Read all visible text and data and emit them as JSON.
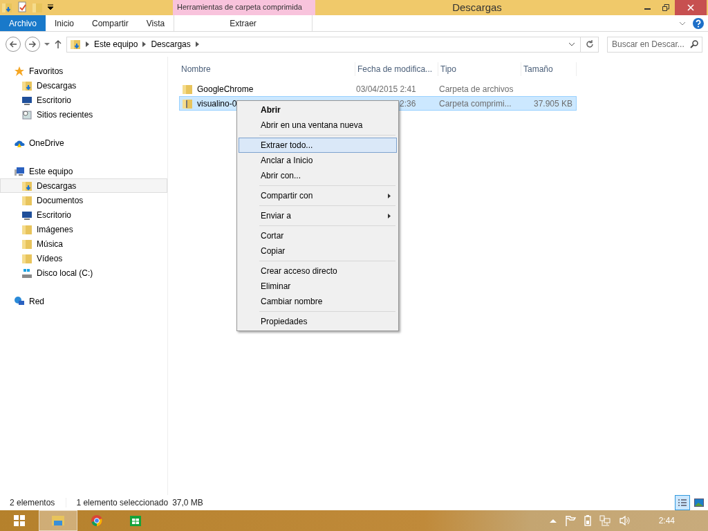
{
  "window": {
    "title": "Descargas"
  },
  "quick_access": [
    {
      "kind": "downloads"
    },
    {
      "kind": "properties"
    },
    {
      "kind": "folder"
    }
  ],
  "ribbon": {
    "context_header": "Herramientas de carpeta comprimida",
    "tabs": [
      {
        "label": "Archivo",
        "kind": "file"
      },
      {
        "label": "Inicio",
        "kind": "tab"
      },
      {
        "label": "Compartir",
        "kind": "tab"
      },
      {
        "label": "Vista",
        "kind": "tab"
      },
      {
        "label": "Extraer",
        "kind": "context"
      }
    ]
  },
  "address": {
    "path": [
      "Este equipo",
      "Descargas"
    ]
  },
  "search": {
    "placeholder": "Buscar en Descar..."
  },
  "sidebar": {
    "items": [
      {
        "label": "Favoritos",
        "kind": "star",
        "selected": false,
        "children": [
          {
            "label": "Descargas",
            "kind": "downloads",
            "selected": false
          },
          {
            "label": "Escritorio",
            "kind": "desktop",
            "selected": false
          },
          {
            "label": "Sitios recientes",
            "kind": "recent",
            "selected": false
          }
        ]
      },
      {
        "label": "OneDrive",
        "kind": "cloud",
        "selected": false
      },
      {
        "label": "Este equipo",
        "kind": "computer",
        "selected": false,
        "children": [
          {
            "label": "Descargas",
            "kind": "downloads",
            "selected": true
          },
          {
            "label": "Documentos",
            "kind": "folder",
            "selected": false
          },
          {
            "label": "Escritorio",
            "kind": "desktop",
            "selected": false
          },
          {
            "label": "Imágenes",
            "kind": "folder",
            "selected": false
          },
          {
            "label": "Música",
            "kind": "folder",
            "selected": false
          },
          {
            "label": "Vídeos",
            "kind": "folder",
            "selected": false
          },
          {
            "label": "Disco local (C:)",
            "kind": "drive",
            "selected": false
          }
        ]
      },
      {
        "label": "Red",
        "kind": "network",
        "selected": false
      }
    ]
  },
  "table": {
    "columns": [
      "Nombre",
      "Fecha de modifica...",
      "Tipo",
      "Tamaño"
    ],
    "rows": [
      {
        "kind": "folder",
        "selected": false,
        "cells": [
          "GoogleChrome",
          "03/04/2015 2:41",
          "Carpeta de archivos",
          ""
        ]
      },
      {
        "kind": "zip",
        "selected": true,
        "cells": [
          "visualino-0",
          "2:36",
          "Carpeta comprimi...",
          "37.905 KB"
        ]
      }
    ]
  },
  "context_menu": {
    "groups": [
      [
        {
          "label": "Abrir",
          "default": true,
          "selected": false,
          "submenu": false
        },
        {
          "label": "Abrir en una ventana nueva",
          "default": false,
          "selected": false,
          "submenu": false
        }
      ],
      [
        {
          "label": "Extraer todo...",
          "default": false,
          "selected": true,
          "submenu": false
        },
        {
          "label": "Anclar a Inicio",
          "default": false,
          "selected": false,
          "submenu": false
        },
        {
          "label": "Abrir con...",
          "default": false,
          "selected": false,
          "submenu": false
        }
      ],
      [
        {
          "label": "Compartir con",
          "default": false,
          "selected": false,
          "submenu": true
        }
      ],
      [
        {
          "label": "Enviar a",
          "default": false,
          "selected": false,
          "submenu": true
        }
      ],
      [
        {
          "label": "Cortar",
          "default": false,
          "selected": false,
          "submenu": false
        },
        {
          "label": "Copiar",
          "default": false,
          "selected": false,
          "submenu": false
        }
      ],
      [
        {
          "label": "Crear acceso directo",
          "default": false,
          "selected": false,
          "submenu": false
        },
        {
          "label": "Eliminar",
          "default": false,
          "selected": false,
          "submenu": false
        },
        {
          "label": "Cambiar nombre",
          "default": false,
          "selected": false,
          "submenu": false
        }
      ],
      [
        {
          "label": "Propiedades",
          "default": false,
          "selected": false,
          "submenu": false
        }
      ]
    ]
  },
  "status_bar": {
    "count": "2 elementos",
    "selection": "1 elemento seleccionado",
    "size": "37,0 MB",
    "views": [
      {
        "kind": "details",
        "selected": true
      },
      {
        "kind": "large",
        "selected": false
      }
    ]
  },
  "taskbar": {
    "apps": [
      {
        "kind": "explorer",
        "selected": true
      },
      {
        "kind": "chrome",
        "selected": false
      },
      {
        "kind": "store",
        "selected": false
      }
    ],
    "clock": "2:44"
  }
}
